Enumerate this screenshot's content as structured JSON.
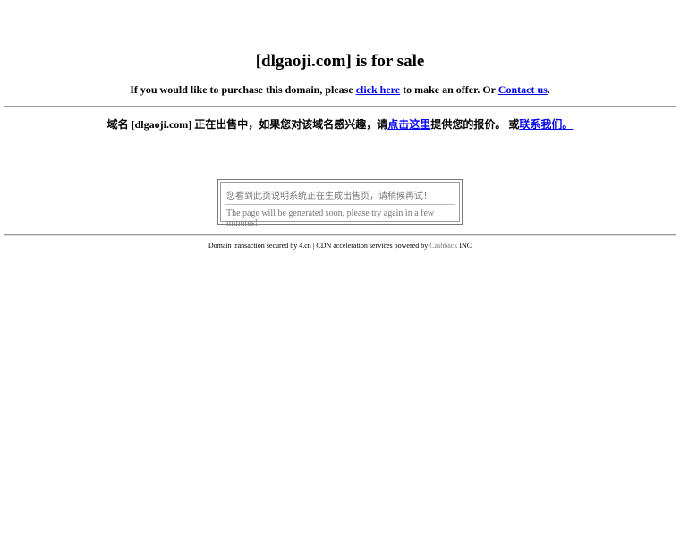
{
  "header": {
    "title": "[dlgaoji.com] is for sale"
  },
  "offer": {
    "prefix": "If you would like to purchase this domain, please ",
    "click_here": "click here",
    "middle": " to make an offer. Or ",
    "contact_us": "Contact us",
    "suffix": "."
  },
  "offer_cn": {
    "prefix": "域名 [dlgaoji.com] 正在出售中，如果您对该域名感兴趣，请",
    "click_here": "点击这里",
    "middle": "提供您的报价。 或",
    "contact_us": "联系我们。"
  },
  "notice": {
    "message_cn": "您看到此页说明系统正在生成出售页，请稍候再试！",
    "message_en": "The page will be generated soon, please try again in a few minutes!"
  },
  "footer": {
    "text": "Domain transaction secured by 4.cn | CDN acceleration services powered by ",
    "brand": "Cashback",
    "suffix": " INC"
  }
}
